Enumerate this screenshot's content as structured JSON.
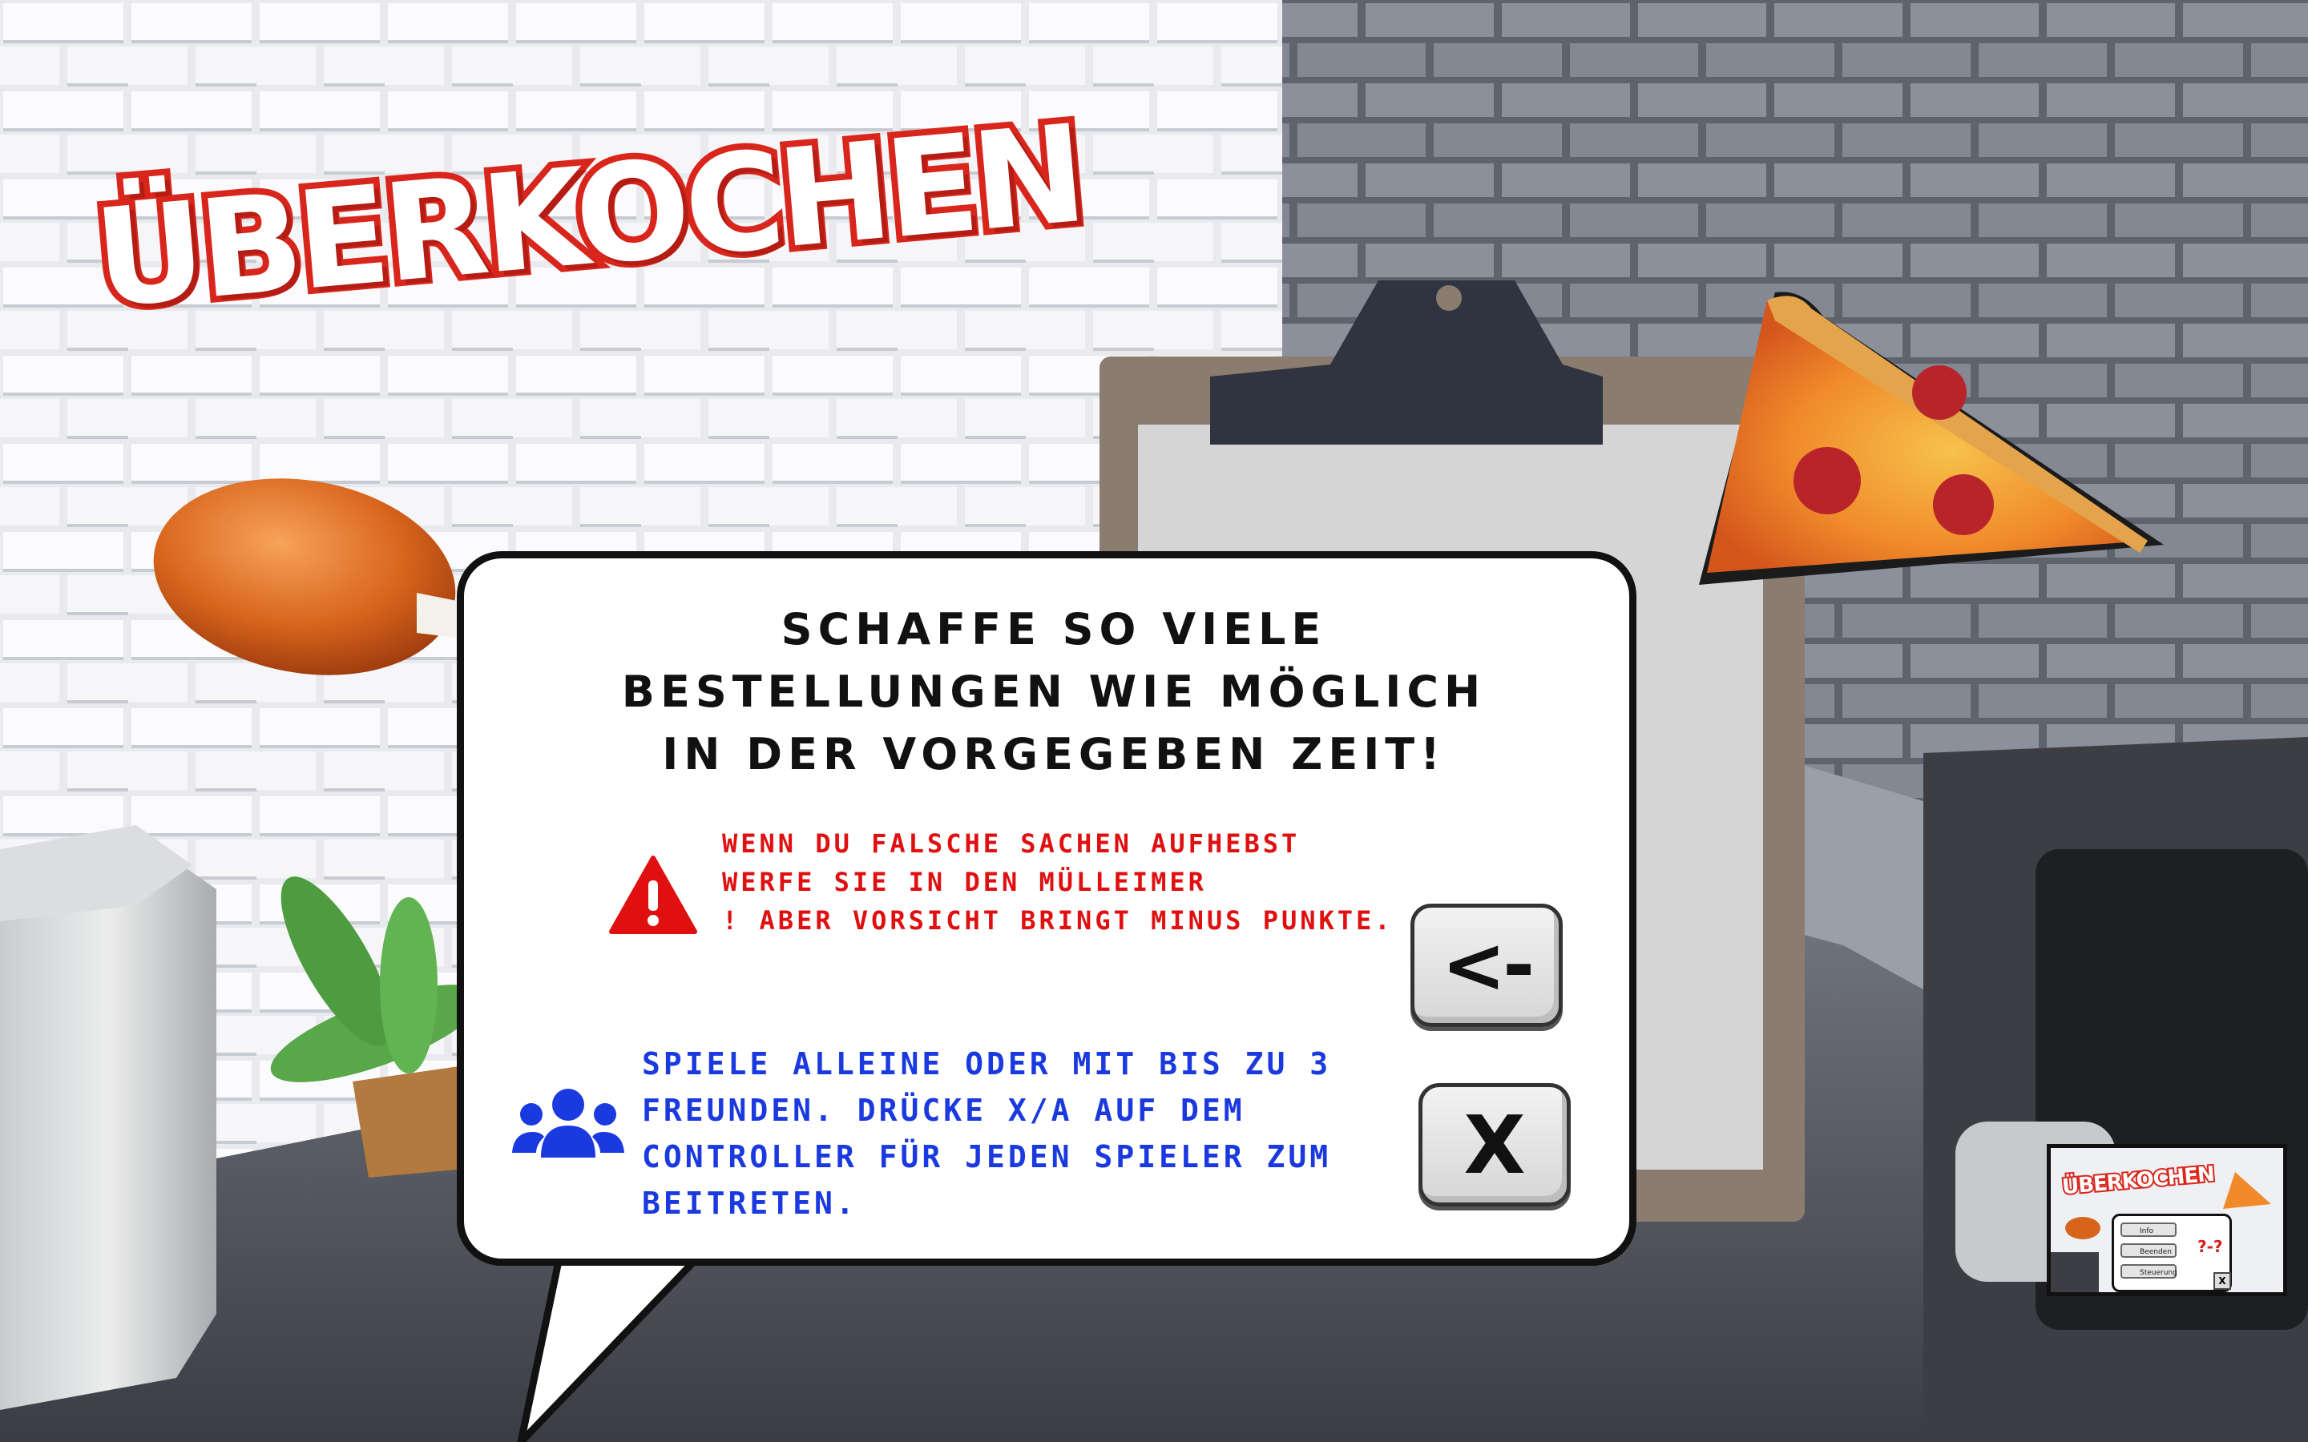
{
  "game": {
    "logo_text": "ÜBERKOCHEN"
  },
  "dialog": {
    "title_lines": [
      "SCHAFFE SO VIELE",
      "BESTELLUNGEN WIE MÖGLICH",
      "IN DER VORGEGEBEN ZEIT!"
    ],
    "warning_lines": [
      "WENN DU FALSCHE SACHEN AUFHEBST",
      "WERFE SIE IN DEN MÜLLEIMER",
      "! ABER VORSICHT BRINGT MINUS PUNKTE."
    ],
    "info_lines": [
      "SPIELE ALLEINE ODER MIT BIS ZU 3",
      "FREUNDEN. DRÜCKE X/A AUF DEM",
      "CONTROLLER FÜR JEDEN SPIELER ZUM",
      "BEITRETEN."
    ],
    "icons": {
      "warning": "warning-triangle-icon",
      "players": "people-group-icon"
    }
  },
  "buttons": {
    "back_label": "<-",
    "close_label": "X"
  },
  "thumbnail": {
    "logo_text": "ÜBERKOCHEN",
    "menu_items": [
      "Info",
      "Beenden",
      "Steuerung"
    ],
    "close_label": "X",
    "question_marks": "?-?"
  },
  "colors": {
    "logo_red": "#d9261c",
    "warning_red": "#e01010",
    "info_blue": "#1a3ae0",
    "dialog_border": "#111111"
  }
}
